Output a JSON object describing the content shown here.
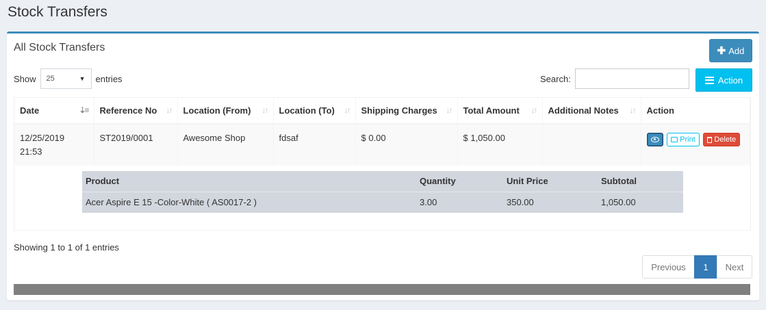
{
  "page": {
    "title": "Stock Transfers"
  },
  "box": {
    "title": "All Stock Transfers",
    "add_label": "Add",
    "show_label": "Show",
    "entries_value": "25",
    "entries_label": "entries",
    "search_label": "Search:",
    "search_value": "",
    "action_label": "Action"
  },
  "table": {
    "columns": [
      "Date",
      "Reference No",
      "Location (From)",
      "Location (To)",
      "Shipping Charges",
      "Total Amount",
      "Additional Notes",
      "Action"
    ],
    "rows": [
      {
        "date": "12/25/2019",
        "time": "21:53",
        "reference_no": "ST2019/0001",
        "location_from": "Awesome Shop",
        "location_to": "fdsaf",
        "shipping_charges": "$ 0.00",
        "total_amount": "$ 1,050.00",
        "additional_notes": "",
        "print_label": "Print",
        "delete_label": "Delete"
      }
    ]
  },
  "detail": {
    "columns": [
      "Product",
      "Quantity",
      "Unit Price",
      "Subtotal"
    ],
    "rows": [
      {
        "product": "Acer Aspire E 15 -Color-White ( AS0017-2 )",
        "quantity": "3.00",
        "unit_price": "350.00",
        "subtotal": "1,050.00"
      }
    ]
  },
  "footer": {
    "showing": "Showing 1 to 1 of 1 entries",
    "prev_label": "Previous",
    "current_page": "1",
    "next_label": "Next"
  },
  "colors": {
    "primary": "#3c8dbc",
    "info": "#00c0ef",
    "danger": "#dd4b39",
    "page_active": "#337ab7"
  },
  "icons": {
    "add": "plus-icon",
    "action": "bars-icon",
    "view": "eye-icon",
    "print": "print-icon",
    "delete": "trash-icon",
    "sort": "sort-icon"
  }
}
